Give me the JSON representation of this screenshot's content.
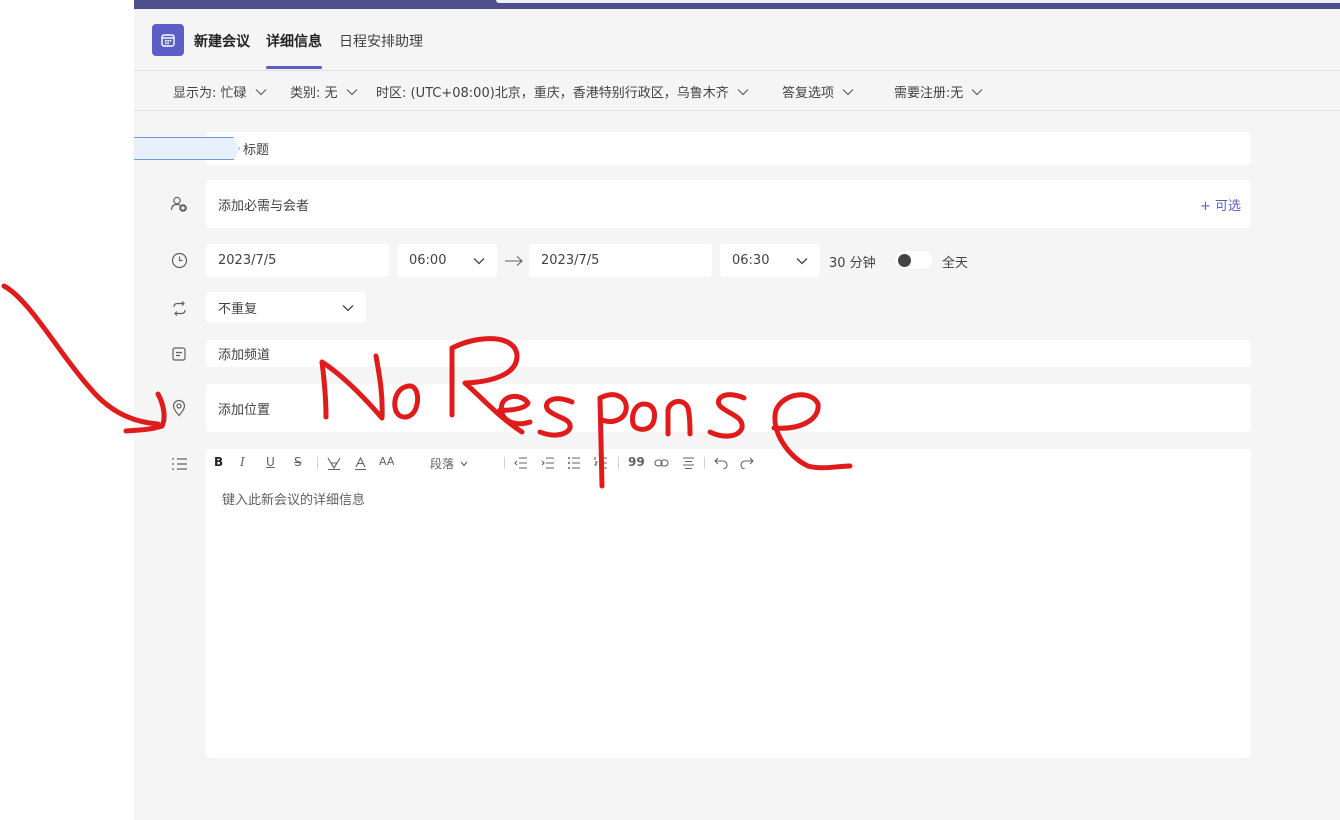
{
  "header": {
    "app_title": "新建会议",
    "tabs": [
      {
        "label": "详细信息"
      },
      {
        "label": "日程安排助理"
      }
    ]
  },
  "options": {
    "show_as": "显示为: 忙碌",
    "category": "类别: 无",
    "timezone": "时区: (UTC+08:00)北京，重庆，香港特别行政区，乌鲁木齐",
    "response_options": "答复选项",
    "registration": "需要注册:无"
  },
  "form": {
    "title_placeholder": "标题",
    "attendees_placeholder": "添加必需与会者",
    "optional_link": "+ 可选",
    "start_date": "2023/7/5",
    "start_time": "06:00",
    "end_date": "2023/7/5",
    "end_time": "06:30",
    "duration": "30 分钟",
    "all_day_label": "全天",
    "all_day_on": false,
    "repeat": "不重复",
    "channel_placeholder": "添加频道",
    "location_placeholder": "添加位置",
    "editor": {
      "paragraph_label": "段落",
      "placeholder": "键入此新会议的详细信息"
    }
  },
  "annotation": {
    "text": "No Response",
    "color": "#e01b1b"
  },
  "colors": {
    "accent": "#5b5fc7",
    "background": "#f5f5f5",
    "field": "#ffffff"
  }
}
